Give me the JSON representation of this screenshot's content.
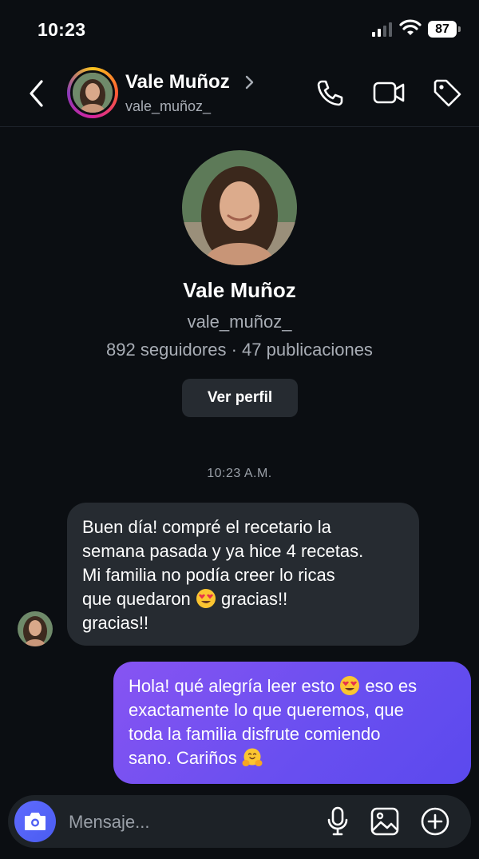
{
  "status_bar": {
    "time": "10:23",
    "battery": "87"
  },
  "header": {
    "name": "Vale Muñoz",
    "handle": "vale_muñoz_"
  },
  "profile": {
    "name": "Vale Muñoz",
    "handle": "vale_muñoz_",
    "stats": "892 seguidores · 47 publicaciones",
    "view_profile_label": "Ver perfil"
  },
  "conversation": {
    "timestamp": "10:23 A.M.",
    "incoming": {
      "lines": [
        "Buen día! compré el recetario la",
        "semana pasada y ya hice 4 recetas.",
        "Mi familia no podía creer lo ricas",
        "que quedaron",
        "gracias!!",
        "gracias!!"
      ]
    },
    "outgoing": {
      "lines": [
        "Hola! qué alegría leer esto",
        "eso es",
        "exactamente lo que queremos, que",
        "toda la familia disfrute comiendo",
        "sano. Cariños"
      ]
    }
  },
  "composer": {
    "placeholder": "Mensaje..."
  },
  "icons": {
    "back": "chevron-left-icon",
    "call": "phone-icon",
    "video": "video-camera-icon",
    "tag": "tag-icon",
    "camera": "camera-icon",
    "mic": "microphone-icon",
    "gallery": "image-icon",
    "add": "plus-circle-icon",
    "emoji_heart_eyes": "heart-eyes-emoji",
    "emoji_hug": "hugging-face-emoji"
  },
  "colors": {
    "background": "#0b0e12",
    "incoming_bubble": "#262b31",
    "outgoing_bubble": "#6a4ff0",
    "camera_button": "#4a5cf0",
    "secondary_text": "#a8adb5"
  }
}
